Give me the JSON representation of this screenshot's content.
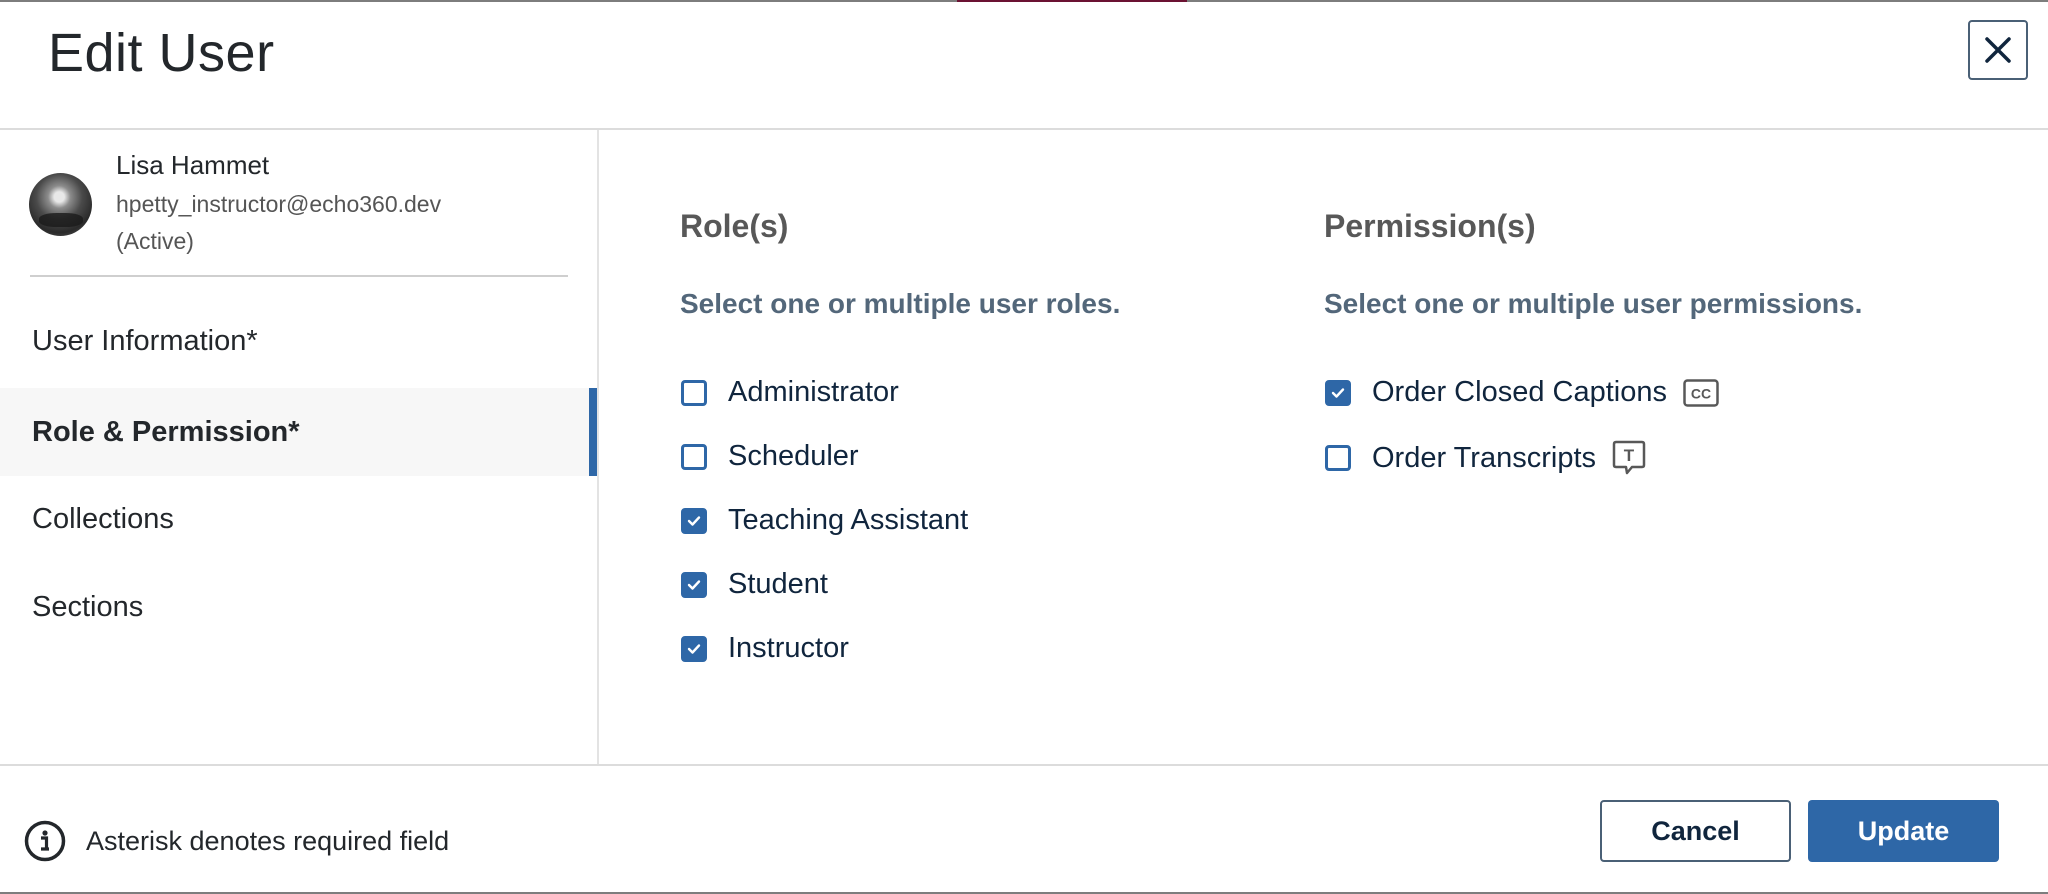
{
  "dialog": {
    "title": "Edit User",
    "close_label": "Close",
    "accent_color": "#2e67a7",
    "top_accent_color": "#6b1232"
  },
  "user": {
    "name": "Lisa Hammet",
    "email": "hpetty_instructor@echo360.dev",
    "status": "(Active)"
  },
  "sidebar": {
    "items": [
      {
        "label": "User Information*",
        "active": false
      },
      {
        "label": "Role & Permission*",
        "active": true
      },
      {
        "label": "Collections",
        "active": false
      },
      {
        "label": "Sections",
        "active": false
      }
    ]
  },
  "roles": {
    "title": "Role(s)",
    "description": "Select one or multiple user roles.",
    "options": [
      {
        "label": "Administrator",
        "checked": false
      },
      {
        "label": "Scheduler",
        "checked": false
      },
      {
        "label": "Teaching Assistant",
        "checked": true
      },
      {
        "label": "Student",
        "checked": true
      },
      {
        "label": "Instructor",
        "checked": true
      }
    ]
  },
  "permissions": {
    "title": "Permission(s)",
    "description": "Select one or multiple user permissions.",
    "options": [
      {
        "label": "Order Closed Captions",
        "checked": true,
        "icon": "closed-captions-icon",
        "icon_text": "CC"
      },
      {
        "label": "Order Transcripts",
        "checked": false,
        "icon": "transcript-icon",
        "icon_text": "T"
      }
    ]
  },
  "footer": {
    "note": "Asterisk denotes required field",
    "cancel_label": "Cancel",
    "update_label": "Update"
  }
}
